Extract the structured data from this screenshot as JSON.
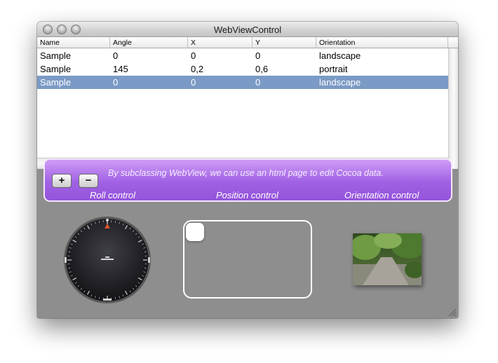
{
  "window": {
    "title": "WebViewControl"
  },
  "table": {
    "columns": [
      "Name",
      "Angle",
      "X",
      "Y",
      "Orientation"
    ],
    "rows": [
      [
        "Sample",
        "0",
        "0",
        "0",
        "landscape"
      ],
      [
        "Sample",
        "145",
        "0,2",
        "0,6",
        "portrait"
      ],
      [
        "Sample",
        "0",
        "0",
        "0",
        "landscape"
      ]
    ],
    "selected_row": 2
  },
  "controls": {
    "add_label": "+",
    "remove_label": "−",
    "description": "By subclassing WebView, we can use an html page to edit Cocoa data.",
    "roll_label": "Roll control",
    "position_label": "Position control",
    "orientation_label": "Orientation control"
  },
  "colors": {
    "selection": "#7b9ac5",
    "banner_top": "#cf9cf6",
    "banner_bottom": "#9454db",
    "window_body": "#8e8e8e",
    "dial_marker": "#e0552b"
  },
  "icons": {
    "close": "traffic-light-close-icon",
    "minimize": "traffic-light-minimize-icon",
    "zoom": "traffic-light-zoom-icon",
    "resize": "resize-grip-icon"
  }
}
